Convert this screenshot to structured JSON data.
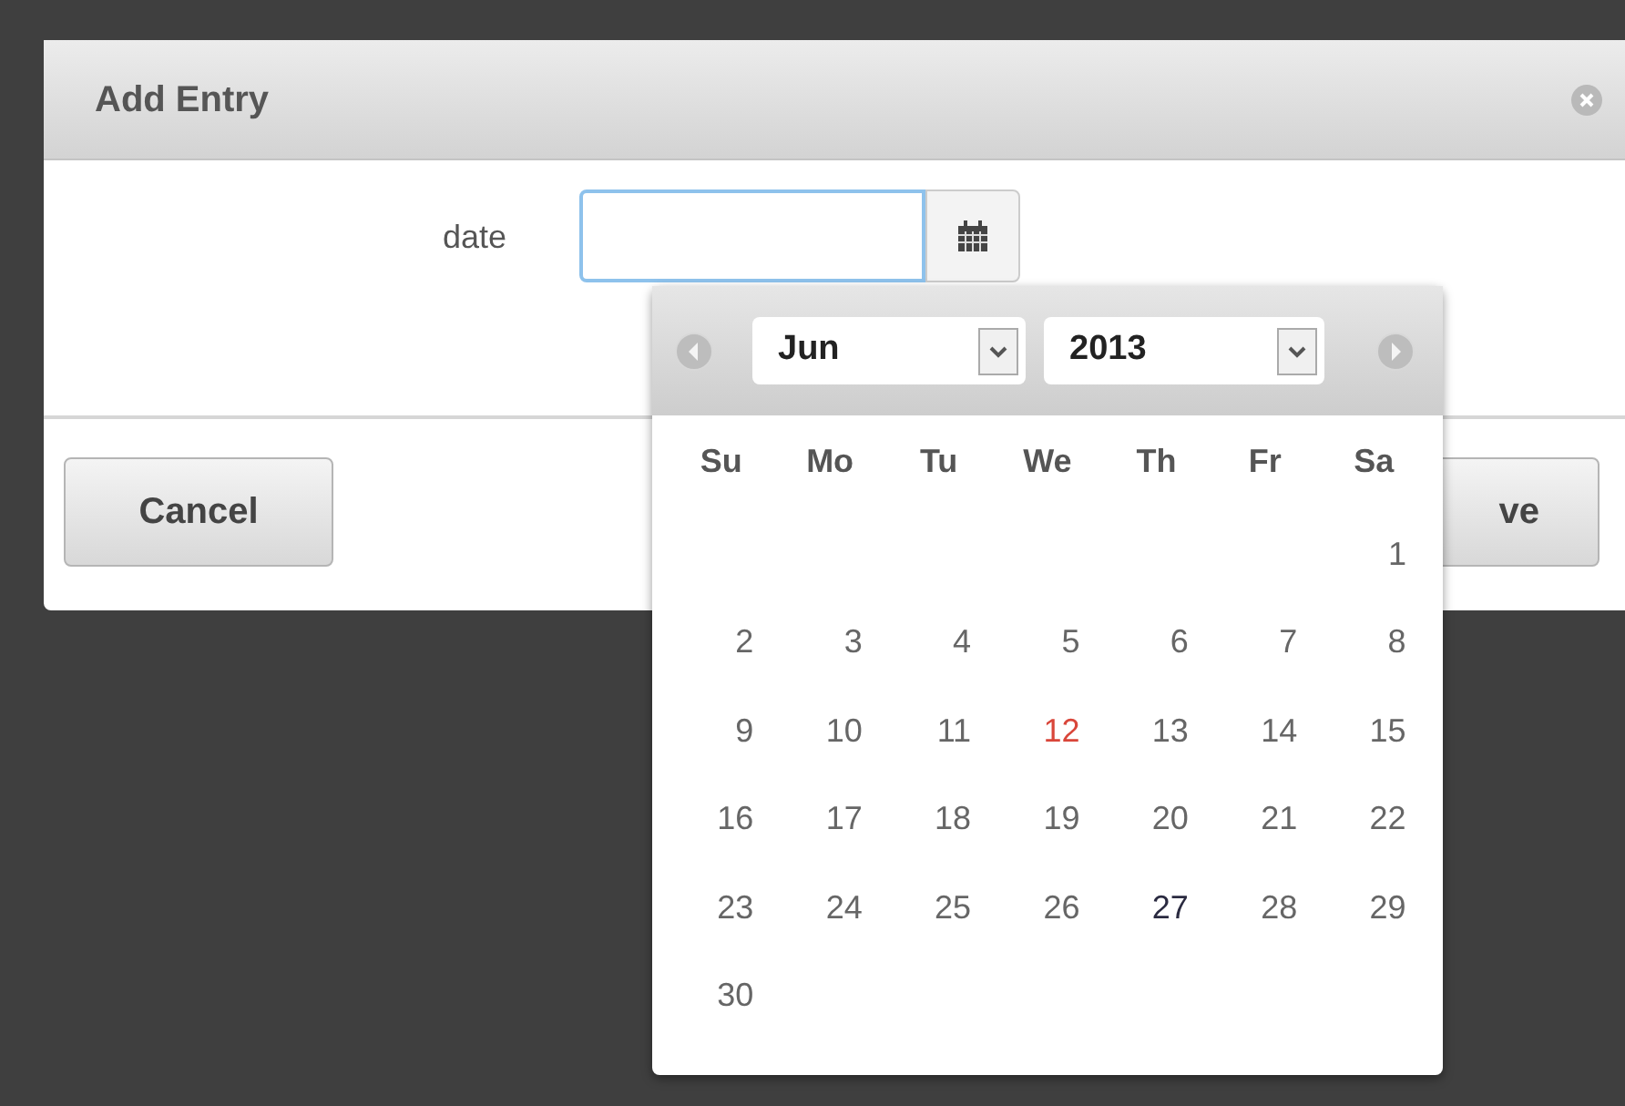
{
  "dialog": {
    "title": "Add Entry"
  },
  "field": {
    "label": "date"
  },
  "buttons": [
    {
      "label": "Cancel",
      "kind": "cancel"
    },
    {
      "label": "ve",
      "kind": "save"
    }
  ],
  "calendar": {
    "month": "Jun",
    "year": "2013",
    "weekdays": [
      "Su",
      "Mo",
      "Tu",
      "We",
      "Th",
      "Fr",
      "Sa"
    ],
    "weeks": [
      [
        {
          "day": "1",
          "kind": "normal"
        }
      ],
      [
        {
          "day": "2",
          "kind": "normal"
        },
        {
          "day": "3",
          "kind": "normal"
        },
        {
          "day": "4",
          "kind": "normal"
        },
        {
          "day": "5",
          "kind": "normal"
        },
        {
          "day": "6",
          "kind": "normal"
        },
        {
          "day": "7",
          "kind": "normal"
        },
        {
          "day": "8",
          "kind": "normal"
        }
      ],
      [
        {
          "day": "9",
          "kind": "normal"
        },
        {
          "day": "10",
          "kind": "normal"
        },
        {
          "day": "11",
          "kind": "normal"
        },
        {
          "day": "12",
          "kind": "today"
        },
        {
          "day": "13",
          "kind": "normal"
        },
        {
          "day": "14",
          "kind": "normal"
        },
        {
          "day": "15",
          "kind": "normal"
        }
      ],
      [
        {
          "day": "16",
          "kind": "normal"
        },
        {
          "day": "17",
          "kind": "normal"
        },
        {
          "day": "18",
          "kind": "normal"
        },
        {
          "day": "19",
          "kind": "normal"
        },
        {
          "day": "20",
          "kind": "normal"
        },
        {
          "day": "21",
          "kind": "normal"
        },
        {
          "day": "22",
          "kind": "normal"
        }
      ],
      [
        {
          "day": "23",
          "kind": "normal"
        },
        {
          "day": "24",
          "kind": "normal"
        },
        {
          "day": "25",
          "kind": "normal"
        },
        {
          "day": "26",
          "kind": "normal"
        },
        {
          "day": "27",
          "kind": "hover"
        },
        {
          "day": "28",
          "kind": "normal"
        },
        {
          "day": "29",
          "kind": "normal"
        }
      ],
      [
        {
          "day": "30",
          "kind": "normal"
        }
      ]
    ]
  }
}
